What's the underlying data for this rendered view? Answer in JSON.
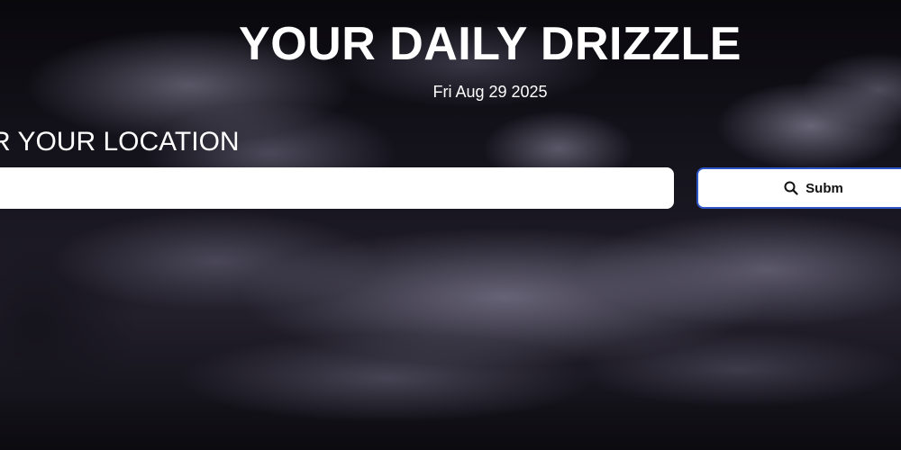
{
  "header": {
    "title": "YOUR DAILY DRIZZLE",
    "date": "Fri Aug 29 2025"
  },
  "location": {
    "label": "R YOUR LOCATION",
    "input_value": "",
    "input_placeholder": ""
  },
  "submit": {
    "label": "Subm",
    "icon": "search-icon",
    "border_color": "#2f56c8"
  },
  "colors": {
    "background": "#0b0a0f",
    "text": "#ffffff"
  }
}
